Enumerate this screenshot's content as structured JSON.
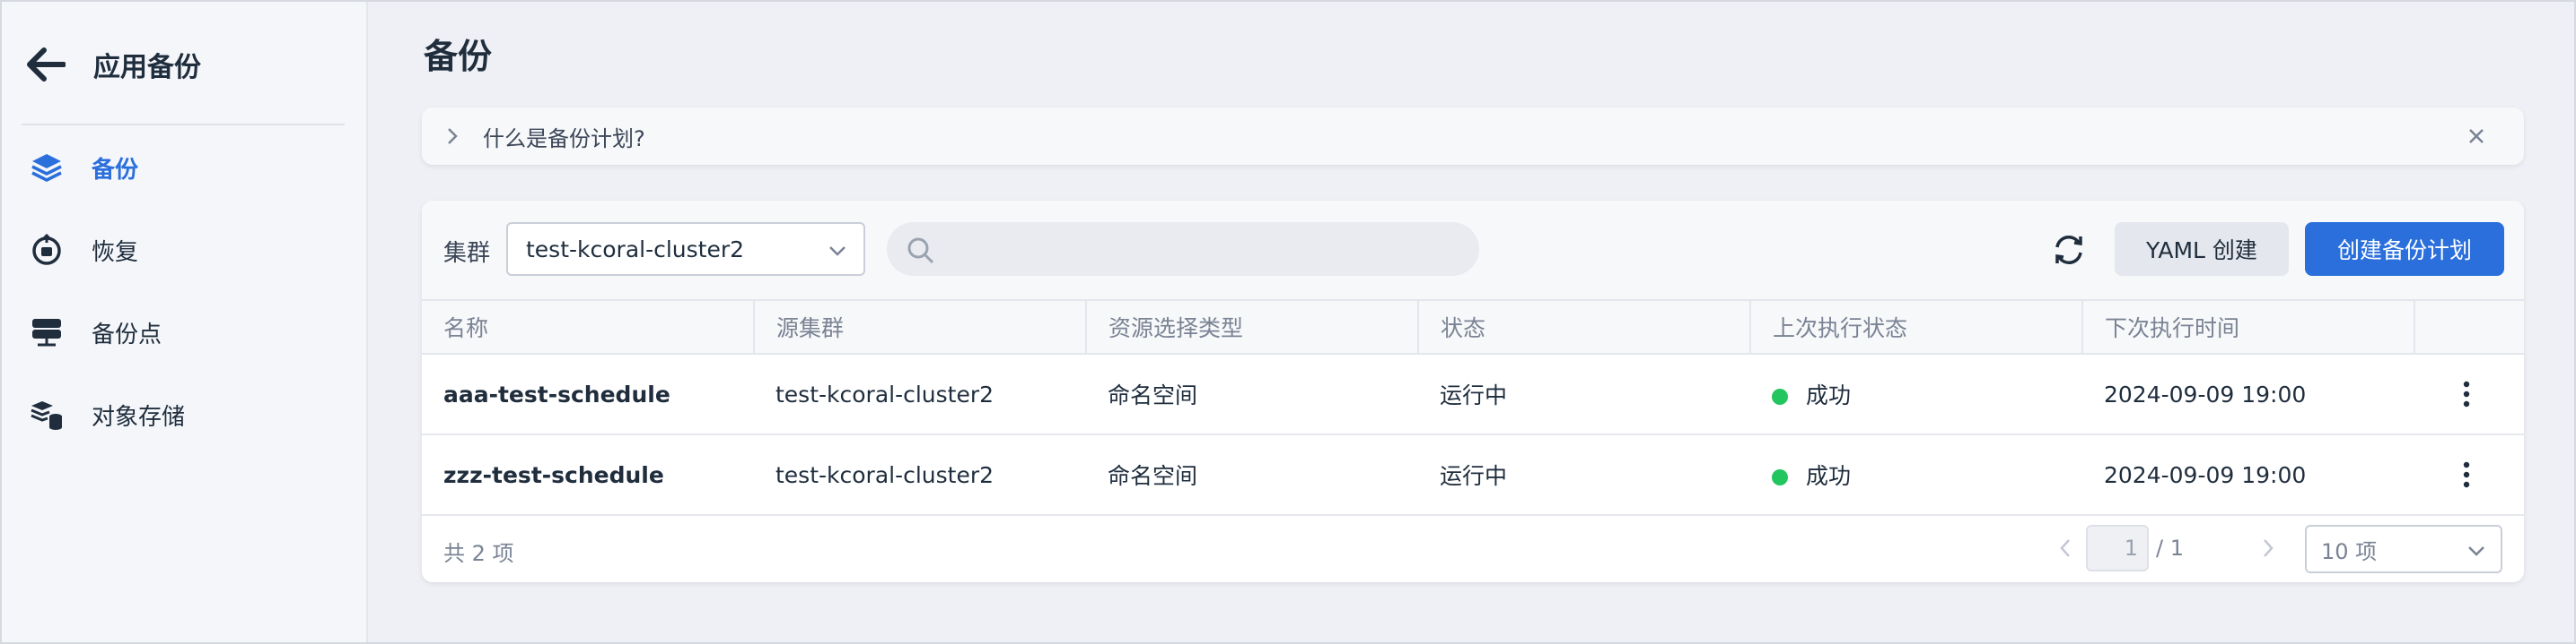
{
  "sidebar": {
    "title": "应用备份",
    "items": [
      {
        "label": "备份",
        "icon": "layers-icon",
        "active": true
      },
      {
        "label": "恢复",
        "icon": "restore-icon",
        "active": false
      },
      {
        "label": "备份点",
        "icon": "backup-point-icon",
        "active": false
      },
      {
        "label": "对象存储",
        "icon": "object-storage-icon",
        "active": false
      }
    ]
  },
  "main": {
    "title": "备份",
    "notice": "什么是备份计划?",
    "toolbar": {
      "cluster_label": "集群",
      "cluster_value": "test-kcoral-cluster2",
      "search_placeholder": "",
      "yaml_button": "YAML 创建",
      "create_button": "创建备份计划"
    },
    "table": {
      "columns": [
        "名称",
        "源集群",
        "资源选择类型",
        "状态",
        "上次执行状态",
        "下次执行时间",
        ""
      ],
      "rows": [
        {
          "name": "aaa-test-schedule",
          "cluster": "test-kcoral-cluster2",
          "resource_type": "命名空间",
          "status": "运行中",
          "last_status": "成功",
          "next_time": "2024-09-09 19:00"
        },
        {
          "name": "zzz-test-schedule",
          "cluster": "test-kcoral-cluster2",
          "resource_type": "命名空间",
          "status": "运行中",
          "last_status": "成功",
          "next_time": "2024-09-09 19:00"
        }
      ]
    },
    "pagination": {
      "total_text": "共 2 项",
      "current_page": "1",
      "total_pages": "/ 1",
      "page_size": "10 项"
    }
  },
  "colors": {
    "accent": "#2a6fdb",
    "success": "#22c55e"
  }
}
